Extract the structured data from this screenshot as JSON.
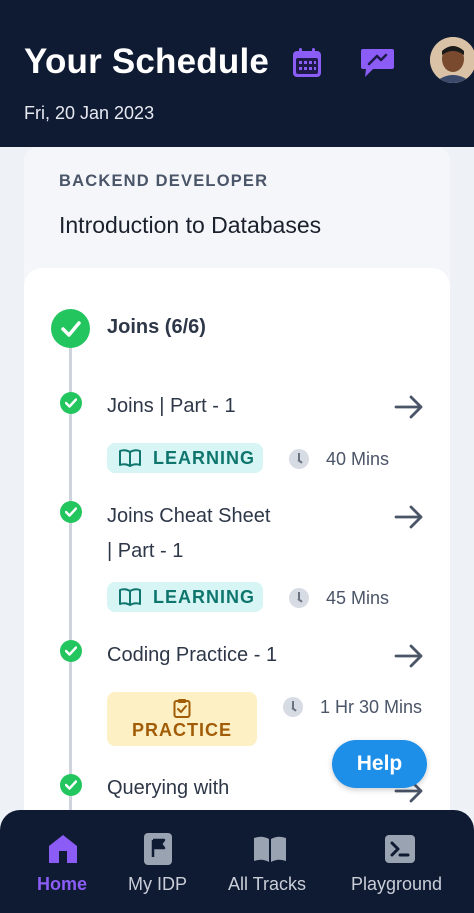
{
  "header": {
    "title": "Your Schedule",
    "date": "Fri, 20 Jan 2023",
    "calendar_icon": "calendar-icon",
    "chat_icon": "chat-icon"
  },
  "course": {
    "track": "BACKEND DEVELOPER",
    "title": "Introduction to Databases"
  },
  "module": {
    "title": "Joins (6/6)"
  },
  "items": [
    {
      "title": "Joins | Part - 1",
      "tag": "LEARNING",
      "duration": "40 Mins"
    },
    {
      "title_line1": "Joins Cheat Sheet",
      "title_line2": "| Part - 1",
      "tag": "LEARNING",
      "duration": "45 Mins"
    },
    {
      "title": "Coding Practice - 1",
      "tag": "PRACTICE",
      "duration": "1 Hr 30 Mins"
    },
    {
      "title": "Querying with"
    }
  ],
  "help": {
    "label": "Help"
  },
  "nav": [
    {
      "label": "Home",
      "icon": "home-icon",
      "active": true
    },
    {
      "label": "My IDP",
      "icon": "flag-icon",
      "active": false
    },
    {
      "label": "All Tracks",
      "icon": "book-icon",
      "active": false
    },
    {
      "label": "Playground",
      "icon": "terminal-icon",
      "active": false
    }
  ],
  "colors": {
    "header_bg": "#0f1a33",
    "accent": "#8b5cf6",
    "success": "#22c55e",
    "help": "#1d8fe8"
  }
}
